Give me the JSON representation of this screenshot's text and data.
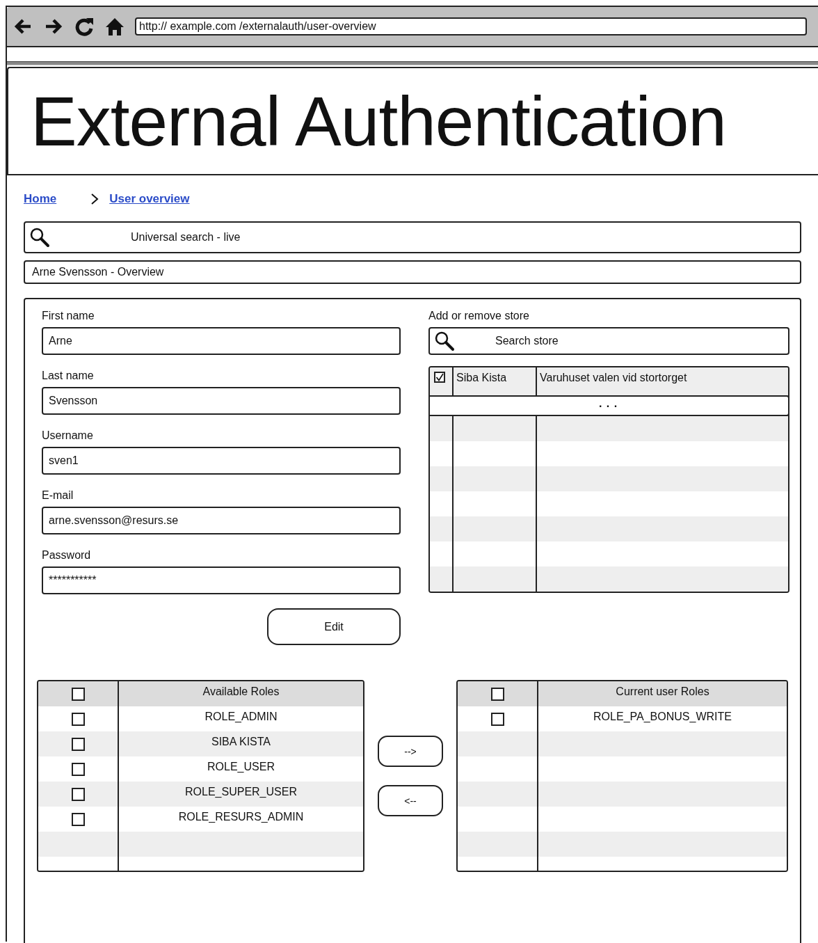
{
  "browser": {
    "url": "http:// example.com /externalauth/user-overview"
  },
  "page_title": "External Authentication",
  "breadcrumb": [
    {
      "label": "Home"
    },
    {
      "label": "User overview"
    }
  ],
  "universal_search": {
    "placeholder": "Universal search - live"
  },
  "section_title": "Arne Svensson - Overview",
  "form": {
    "fields": [
      {
        "label": "First name",
        "value": "Arne"
      },
      {
        "label": "Last name",
        "value": "Svensson"
      },
      {
        "label": "Username",
        "value": "sven1"
      },
      {
        "label": "E-mail",
        "value": "arne.svensson@resurs.se"
      },
      {
        "label": "Password",
        "value": "***********"
      }
    ],
    "edit_button": "Edit"
  },
  "stores": {
    "label": "Add or remove store",
    "search": {
      "placeholder": "Search store"
    },
    "rows": [
      {
        "checked": true,
        "name": "Siba Kista",
        "description": "Varuhuset valen vid stortorget"
      }
    ],
    "more_indicator": ". . ."
  },
  "available_roles": {
    "header": "Available Roles",
    "header_checked": false,
    "rows": [
      {
        "name": "ROLE_ADMIN",
        "checked": false
      },
      {
        "name": "SIBA KISTA",
        "checked": false
      },
      {
        "name": "ROLE_USER",
        "checked": false
      },
      {
        "name": "ROLE_SUPER_USER",
        "checked": false
      },
      {
        "name": "ROLE_RESURS_ADMIN",
        "checked": false
      }
    ]
  },
  "move_buttons": [
    {
      "label": "-->"
    },
    {
      "label": "<--"
    }
  ],
  "current_roles": {
    "header": "Current user Roles",
    "header_checked": false,
    "rows": [
      {
        "name": "ROLE_PA_BONUS_WRITE",
        "checked": false
      }
    ]
  }
}
